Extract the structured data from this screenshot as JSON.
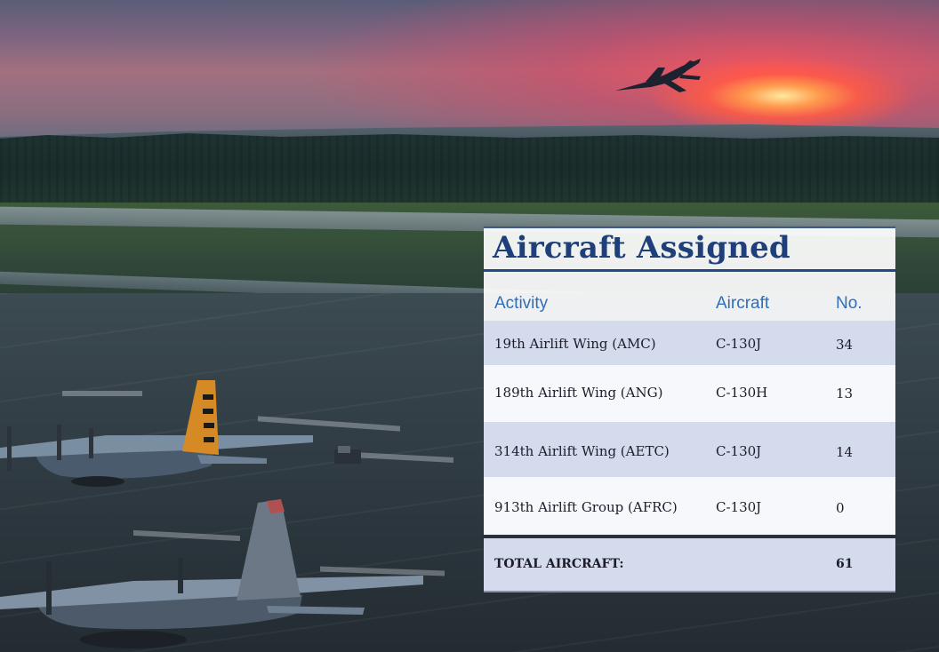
{
  "panel": {
    "title": "Aircraft Assigned",
    "headers": {
      "activity": "Activity",
      "aircraft": "Aircraft",
      "number": "No."
    },
    "rows": [
      {
        "activity": "19th Airlift Wing (AMC)",
        "aircraft": "C-130J",
        "number": "34"
      },
      {
        "activity": "189th Airlift Wing (ANG)",
        "aircraft": "C-130H",
        "number": "13"
      },
      {
        "activity": "314th Airlift Wing (AETC)",
        "aircraft": "C-130J",
        "number": "14"
      },
      {
        "activity": "913th Airlift Group (AFRC)",
        "aircraft": "C-130J",
        "number": "0"
      }
    ],
    "total": {
      "label": "TOTAL AIRCRAFT:",
      "number": "61"
    }
  },
  "colors": {
    "title": "#1e3f7a",
    "header": "#2f6fb8",
    "row_shade": "#d3dbec",
    "rule": "#234a82"
  },
  "background": {
    "description_icon": "airfield-sunset-photo"
  }
}
